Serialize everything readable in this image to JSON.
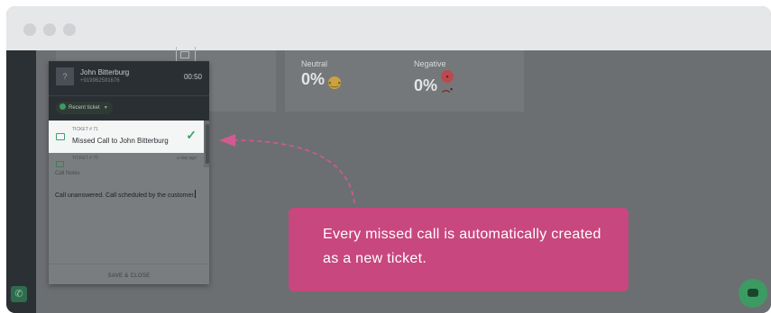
{
  "stats": {
    "neutral": {
      "label": "Neutral",
      "value": "0%",
      "icon": "neutral-face-icon"
    },
    "negative": {
      "label": "Negative",
      "value": "0%",
      "icon": "sad-face-icon"
    }
  },
  "call_panel": {
    "caller_name": "John Bitterburg",
    "caller_number": "+919962591676",
    "timer": "00:50",
    "recent_ticket_label": "Recent ticket",
    "tickets": [
      {
        "id": "TICKET # 71",
        "title": "Missed Call to John Bitterburg",
        "selected": true
      },
      {
        "id": "TICKET # 70",
        "time": "a day ago"
      }
    ],
    "notes_label": "Call Notes",
    "notes_text": "Call unanswered. Call scheduled by the customer.",
    "save_button": "SAVE & CLOSE"
  },
  "callout": {
    "text": "Every missed call is automatically created as a new ticket."
  },
  "colors": {
    "accent_pink": "#c8477e",
    "accent_green": "#3b9b63",
    "sidebar_dark": "#2b3034"
  }
}
